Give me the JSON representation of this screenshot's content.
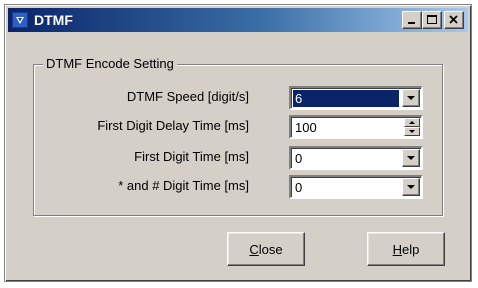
{
  "window": {
    "title": "DTMF",
    "icon": "app-icon",
    "controls": [
      "minimize-icon",
      "maximize-icon",
      "close-icon"
    ]
  },
  "group": {
    "label": "DTMF Encode Setting"
  },
  "fields": [
    {
      "label": "DTMF Speed [digit/s]",
      "value": "6",
      "control": "dropdown",
      "selected": true
    },
    {
      "label": "First Digit Delay Time [ms]",
      "value": "100",
      "control": "spinner"
    },
    {
      "label": "First Digit Time [ms]",
      "value": "0",
      "control": "dropdown"
    },
    {
      "label": "* and # Digit Time [ms]",
      "value": "0",
      "control": "dropdown"
    }
  ],
  "buttons": {
    "close": {
      "mnemonic": "C",
      "rest": "lose"
    },
    "help": {
      "mnemonic": "H",
      "rest": "elp"
    }
  },
  "colors": {
    "title_start": "#0a246a",
    "title_end": "#a6caf0",
    "face": "#d4d0c8",
    "selection": "#0a246a"
  }
}
